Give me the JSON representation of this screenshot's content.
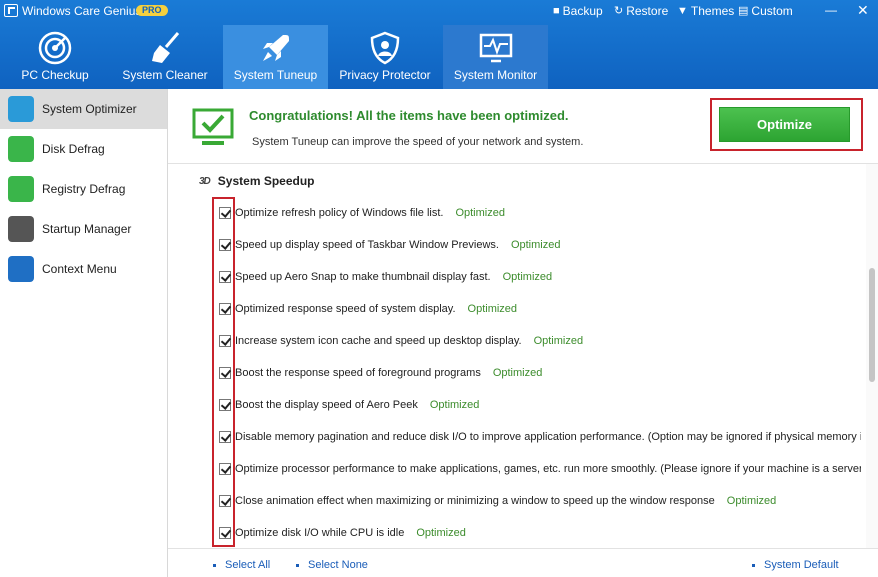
{
  "app": {
    "title": "Windows Care Genius",
    "badge": "PRO"
  },
  "toolbar": {
    "backup": "Backup",
    "restore": "Restore",
    "themes": "Themes",
    "custom": "Custom",
    "minimize": "—",
    "close": "✕"
  },
  "nav": {
    "tabs": [
      {
        "label": "PC Checkup"
      },
      {
        "label": "System Cleaner"
      },
      {
        "label": "System Tuneup"
      },
      {
        "label": "Privacy Protector"
      },
      {
        "label": "System Monitor"
      }
    ]
  },
  "sidebar": {
    "items": [
      {
        "label": "System Optimizer"
      },
      {
        "label": "Disk Defrag"
      },
      {
        "label": "Registry Defrag"
      },
      {
        "label": "Startup Manager"
      },
      {
        "label": "Context Menu"
      }
    ]
  },
  "header": {
    "congrats": "Congratulations! All the items have been optimized.",
    "subtitle": "System Tuneup can improve the speed of your network and system.",
    "optimize_label": "Optimize"
  },
  "section": {
    "title": "System Speedup",
    "icon_text": "3D"
  },
  "items": [
    {
      "text": "Optimize refresh policy of Windows file list.",
      "status": "Optimized"
    },
    {
      "text": "Speed up display speed of Taskbar Window Previews.",
      "status": "Optimized"
    },
    {
      "text": "Speed up Aero Snap to make thumbnail display fast.",
      "status": "Optimized"
    },
    {
      "text": "Optimized response speed of system display.",
      "status": "Optimized"
    },
    {
      "text": "Increase system icon cache and speed up desktop display.",
      "status": "Optimized"
    },
    {
      "text": "Boost the response speed of foreground programs",
      "status": "Optimized"
    },
    {
      "text": "Boost the display speed of Aero Peek",
      "status": "Optimized"
    },
    {
      "text": "Disable memory pagination and reduce disk I/O to improve application performance. (Option may be ignored if physical memory i...",
      "status": ""
    },
    {
      "text": "Optimize processor performance to make applications, games, etc. run more smoothly. (Please ignore if your machine is a server.)",
      "status": ""
    },
    {
      "text": "Close animation effect when maximizing or minimizing a window  to speed up the window response",
      "status": "Optimized"
    },
    {
      "text": "Optimize disk I/O while CPU is idle",
      "status": "Optimized"
    }
  ],
  "footer": {
    "select_all": "Select All",
    "select_none": "Select None",
    "system_default": "System Default"
  }
}
